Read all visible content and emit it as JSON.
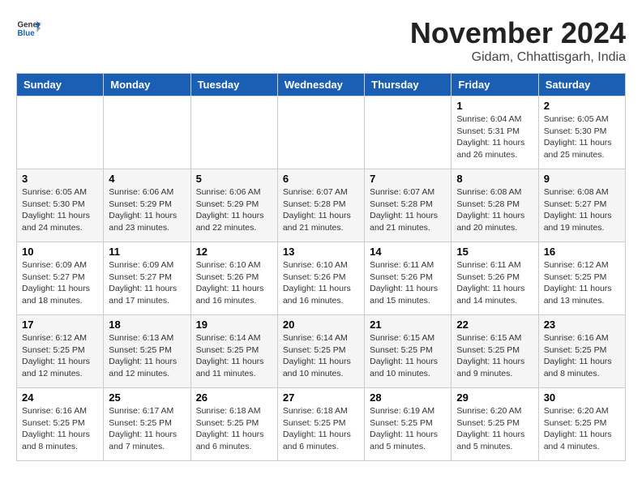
{
  "header": {
    "logo_general": "General",
    "logo_blue": "Blue",
    "month": "November 2024",
    "location": "Gidam, Chhattisgarh, India"
  },
  "weekdays": [
    "Sunday",
    "Monday",
    "Tuesday",
    "Wednesday",
    "Thursday",
    "Friday",
    "Saturday"
  ],
  "weeks": [
    [
      {
        "day": "",
        "info": ""
      },
      {
        "day": "",
        "info": ""
      },
      {
        "day": "",
        "info": ""
      },
      {
        "day": "",
        "info": ""
      },
      {
        "day": "",
        "info": ""
      },
      {
        "day": "1",
        "info": "Sunrise: 6:04 AM\nSunset: 5:31 PM\nDaylight: 11 hours and 26 minutes."
      },
      {
        "day": "2",
        "info": "Sunrise: 6:05 AM\nSunset: 5:30 PM\nDaylight: 11 hours and 25 minutes."
      }
    ],
    [
      {
        "day": "3",
        "info": "Sunrise: 6:05 AM\nSunset: 5:30 PM\nDaylight: 11 hours and 24 minutes."
      },
      {
        "day": "4",
        "info": "Sunrise: 6:06 AM\nSunset: 5:29 PM\nDaylight: 11 hours and 23 minutes."
      },
      {
        "day": "5",
        "info": "Sunrise: 6:06 AM\nSunset: 5:29 PM\nDaylight: 11 hours and 22 minutes."
      },
      {
        "day": "6",
        "info": "Sunrise: 6:07 AM\nSunset: 5:28 PM\nDaylight: 11 hours and 21 minutes."
      },
      {
        "day": "7",
        "info": "Sunrise: 6:07 AM\nSunset: 5:28 PM\nDaylight: 11 hours and 21 minutes."
      },
      {
        "day": "8",
        "info": "Sunrise: 6:08 AM\nSunset: 5:28 PM\nDaylight: 11 hours and 20 minutes."
      },
      {
        "day": "9",
        "info": "Sunrise: 6:08 AM\nSunset: 5:27 PM\nDaylight: 11 hours and 19 minutes."
      }
    ],
    [
      {
        "day": "10",
        "info": "Sunrise: 6:09 AM\nSunset: 5:27 PM\nDaylight: 11 hours and 18 minutes."
      },
      {
        "day": "11",
        "info": "Sunrise: 6:09 AM\nSunset: 5:27 PM\nDaylight: 11 hours and 17 minutes."
      },
      {
        "day": "12",
        "info": "Sunrise: 6:10 AM\nSunset: 5:26 PM\nDaylight: 11 hours and 16 minutes."
      },
      {
        "day": "13",
        "info": "Sunrise: 6:10 AM\nSunset: 5:26 PM\nDaylight: 11 hours and 16 minutes."
      },
      {
        "day": "14",
        "info": "Sunrise: 6:11 AM\nSunset: 5:26 PM\nDaylight: 11 hours and 15 minutes."
      },
      {
        "day": "15",
        "info": "Sunrise: 6:11 AM\nSunset: 5:26 PM\nDaylight: 11 hours and 14 minutes."
      },
      {
        "day": "16",
        "info": "Sunrise: 6:12 AM\nSunset: 5:25 PM\nDaylight: 11 hours and 13 minutes."
      }
    ],
    [
      {
        "day": "17",
        "info": "Sunrise: 6:12 AM\nSunset: 5:25 PM\nDaylight: 11 hours and 12 minutes."
      },
      {
        "day": "18",
        "info": "Sunrise: 6:13 AM\nSunset: 5:25 PM\nDaylight: 11 hours and 12 minutes."
      },
      {
        "day": "19",
        "info": "Sunrise: 6:14 AM\nSunset: 5:25 PM\nDaylight: 11 hours and 11 minutes."
      },
      {
        "day": "20",
        "info": "Sunrise: 6:14 AM\nSunset: 5:25 PM\nDaylight: 11 hours and 10 minutes."
      },
      {
        "day": "21",
        "info": "Sunrise: 6:15 AM\nSunset: 5:25 PM\nDaylight: 11 hours and 10 minutes."
      },
      {
        "day": "22",
        "info": "Sunrise: 6:15 AM\nSunset: 5:25 PM\nDaylight: 11 hours and 9 minutes."
      },
      {
        "day": "23",
        "info": "Sunrise: 6:16 AM\nSunset: 5:25 PM\nDaylight: 11 hours and 8 minutes."
      }
    ],
    [
      {
        "day": "24",
        "info": "Sunrise: 6:16 AM\nSunset: 5:25 PM\nDaylight: 11 hours and 8 minutes."
      },
      {
        "day": "25",
        "info": "Sunrise: 6:17 AM\nSunset: 5:25 PM\nDaylight: 11 hours and 7 minutes."
      },
      {
        "day": "26",
        "info": "Sunrise: 6:18 AM\nSunset: 5:25 PM\nDaylight: 11 hours and 6 minutes."
      },
      {
        "day": "27",
        "info": "Sunrise: 6:18 AM\nSunset: 5:25 PM\nDaylight: 11 hours and 6 minutes."
      },
      {
        "day": "28",
        "info": "Sunrise: 6:19 AM\nSunset: 5:25 PM\nDaylight: 11 hours and 5 minutes."
      },
      {
        "day": "29",
        "info": "Sunrise: 6:20 AM\nSunset: 5:25 PM\nDaylight: 11 hours and 5 minutes."
      },
      {
        "day": "30",
        "info": "Sunrise: 6:20 AM\nSunset: 5:25 PM\nDaylight: 11 hours and 4 minutes."
      }
    ]
  ]
}
